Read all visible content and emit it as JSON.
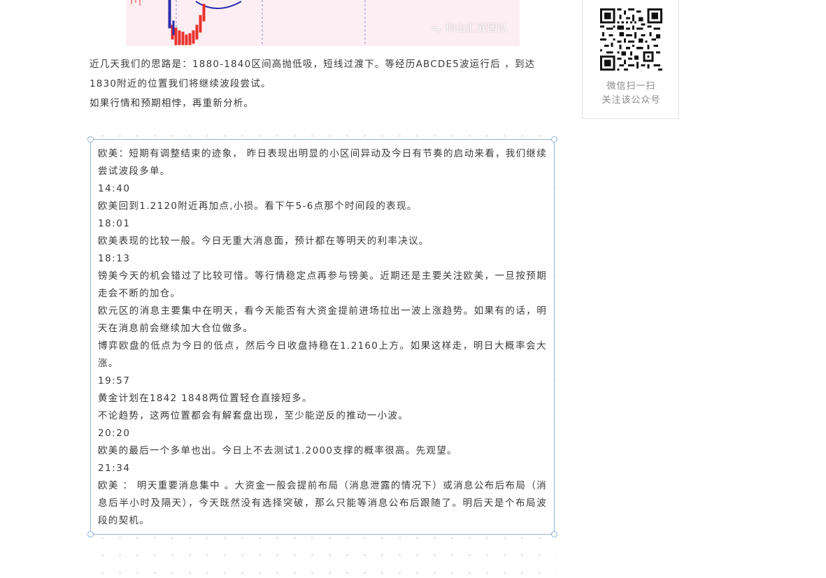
{
  "chart_image": {
    "watermark": "仰山汇巽团队",
    "watermark_icon": "wechat-icon"
  },
  "intro": {
    "line1": "近几天我们的思路是：1880-1840区间高抛低吸，短线过渡下。等经历ABCDE5波运行后 ，到达1830附近的位置我们将继续波段尝试。",
    "line2": "如果行情和预期相悖，再重新分析。"
  },
  "note": {
    "lines": [
      "欧美：短期有调整结束的迹象，  昨日表现出明显的小区间异动及今日有节奏的启动来看，我们继续尝试波段多单。",
      "14:40",
      "欧美回到1.2120附近再加点,小损。看下午5-6点那个时间段的表现。",
      "18:01",
      "欧美表现的比较一般。今日无重大消息面，预计都在等明天的利率决议。",
      "18:13",
      "镑美今天的机会错过了比较可惜。等行情稳定点再参与镑美。近期还是主要关注欧美，一旦按预期走会不断的加仓。",
      "欧元区的消息主要集中在明天，看今天能否有大资金提前进场拉出一波上涨趋势。如果有的话，明天在消息前会继续加大仓位做多。",
      "博弈欧盘的低点为今日的低点，然后今日收盘持稳在1.2160上方。如果这样走，明日大概率会大涨。",
      "19:57",
      "黄金计划在1842  1848两位置轻仓直接短多。",
      "不论趋势，这两位置都会有解套盘出现，至少能逆反的推动一小波。",
      "20:20",
      "欧美的最后一个多单也出。今日上不去测试1.2000支撑的概率很高。先观望。",
      "21:34",
      "欧美 ：  明天重要消息集中 。大资金一般会提前布局（消息泄露的情况下）或消息公布后布局（消息后半小时及隔天），今天既然没有选择突破，那么只能等消息公布后跟随了。明后天是个布局波段的契机。"
    ]
  },
  "qr_card": {
    "caption_line1": "微信扫一扫",
    "caption_line2": "关注该公众号"
  },
  "colors": {
    "chart_bg": "#fdeef3",
    "candle_red": "#e8322b",
    "candle_blue": "#2a2fb0",
    "box_border": "#8fb3cf",
    "text": "#3a3a3a"
  }
}
